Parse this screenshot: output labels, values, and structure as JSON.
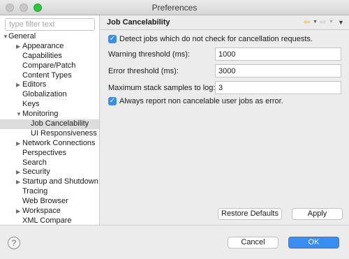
{
  "window": {
    "title": "Preferences"
  },
  "sidebar": {
    "filter_placeholder": "type filter text",
    "items": [
      {
        "label": "General",
        "expanded": true
      },
      {
        "label": "Appearance",
        "expandable": true
      },
      {
        "label": "Capabilities"
      },
      {
        "label": "Compare/Patch"
      },
      {
        "label": "Content Types"
      },
      {
        "label": "Editors",
        "expandable": true
      },
      {
        "label": "Globalization"
      },
      {
        "label": "Keys"
      },
      {
        "label": "Monitoring",
        "expanded": true
      },
      {
        "label": "Job Cancelability",
        "selected": true
      },
      {
        "label": "UI Responsiveness"
      },
      {
        "label": "Network Connections",
        "expandable": true
      },
      {
        "label": "Perspectives"
      },
      {
        "label": "Search"
      },
      {
        "label": "Security",
        "expandable": true
      },
      {
        "label": "Startup and Shutdown",
        "expandable": true
      },
      {
        "label": "Tracing"
      },
      {
        "label": "Web Browser"
      },
      {
        "label": "Workspace",
        "expandable": true
      },
      {
        "label": "XML Compare"
      }
    ]
  },
  "page": {
    "title": "Job Cancelability",
    "detect_jobs": {
      "label": "Detect jobs which do not check for cancellation requests.",
      "checked": true
    },
    "warning_threshold": {
      "label": "Warning threshold (ms):",
      "value": "1000"
    },
    "error_threshold": {
      "label": "Error threshold (ms):",
      "value": "3000"
    },
    "max_stack_samples": {
      "label": "Maximum stack samples to log:",
      "value": "3"
    },
    "always_report": {
      "label": "Always report non cancelable user jobs as error.",
      "checked": true
    },
    "restore_defaults_label": "Restore Defaults",
    "apply_label": "Apply"
  },
  "footer": {
    "help_label": "?",
    "cancel_label": "Cancel",
    "ok_label": "OK"
  },
  "icons": {
    "back": "arrow-left-icon",
    "forward": "arrow-right-icon",
    "view_menu": "chevron-down-icon"
  },
  "colors": {
    "accent": "#3b8ef1",
    "checkbox": "#3a8ee6",
    "back_arrow": "#e8a03a"
  }
}
